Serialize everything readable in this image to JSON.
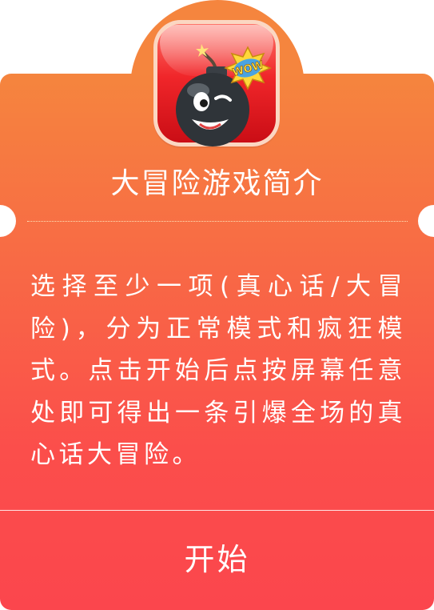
{
  "dialog": {
    "icon": "bomb-wow-icon",
    "badge_text": "WOW",
    "title": "大冒险游戏简介",
    "description": "选择至少一项(真心话/大冒险)，分为正常模式和疯狂模式。点击开始后点按屏幕任意处即可得出一条引爆全场的真心话大冒险。",
    "start_label": "开始"
  },
  "colors": {
    "gradient_top": "#f5853e",
    "gradient_bottom": "#fb464d",
    "text": "#ffffff",
    "icon_red": "#f0262a"
  }
}
